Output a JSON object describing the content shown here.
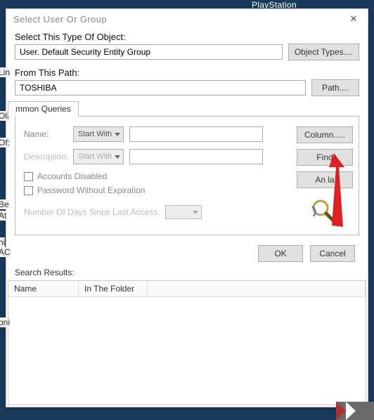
{
  "background": {
    "playstation_text": "PlayStation"
  },
  "dialog": {
    "title": "Select User Or Group",
    "close_glyph": "✕",
    "object_label": "Select This Type Of Object:",
    "object_value": "User. Default Security Entity Group",
    "object_types_btn": "Object Types....",
    "path_label": "From This Path:",
    "path_value": "TOSHIBA",
    "path_btn": "Path....",
    "tab_label": "mmon Queries",
    "queries": {
      "name_label": "Name:",
      "name_dropdown": "Start With",
      "desc_label": "Description:",
      "desc_dropdown": "Start With",
      "accounts_disabled": "Accounts Disabled",
      "pw_no_expire": "Password Without Expiration",
      "days_label": "Number Of Days Since Last Access:"
    },
    "side_buttons": {
      "column": "Column.....",
      "find": "Find",
      "annulla": "An    la"
    },
    "footer": {
      "ok": "OK",
      "cancel": "Cancel"
    },
    "results_label": "Search Results:",
    "columns": {
      "name": "Name",
      "folder": "In The Folder"
    }
  },
  "edge": {
    "t1": "Oll",
    "t2": "Lin",
    "t3": "Of:",
    "t4": "Be",
    "t5": "At",
    "t6": "hi",
    "t7": "AC",
    "t8": "oni"
  }
}
